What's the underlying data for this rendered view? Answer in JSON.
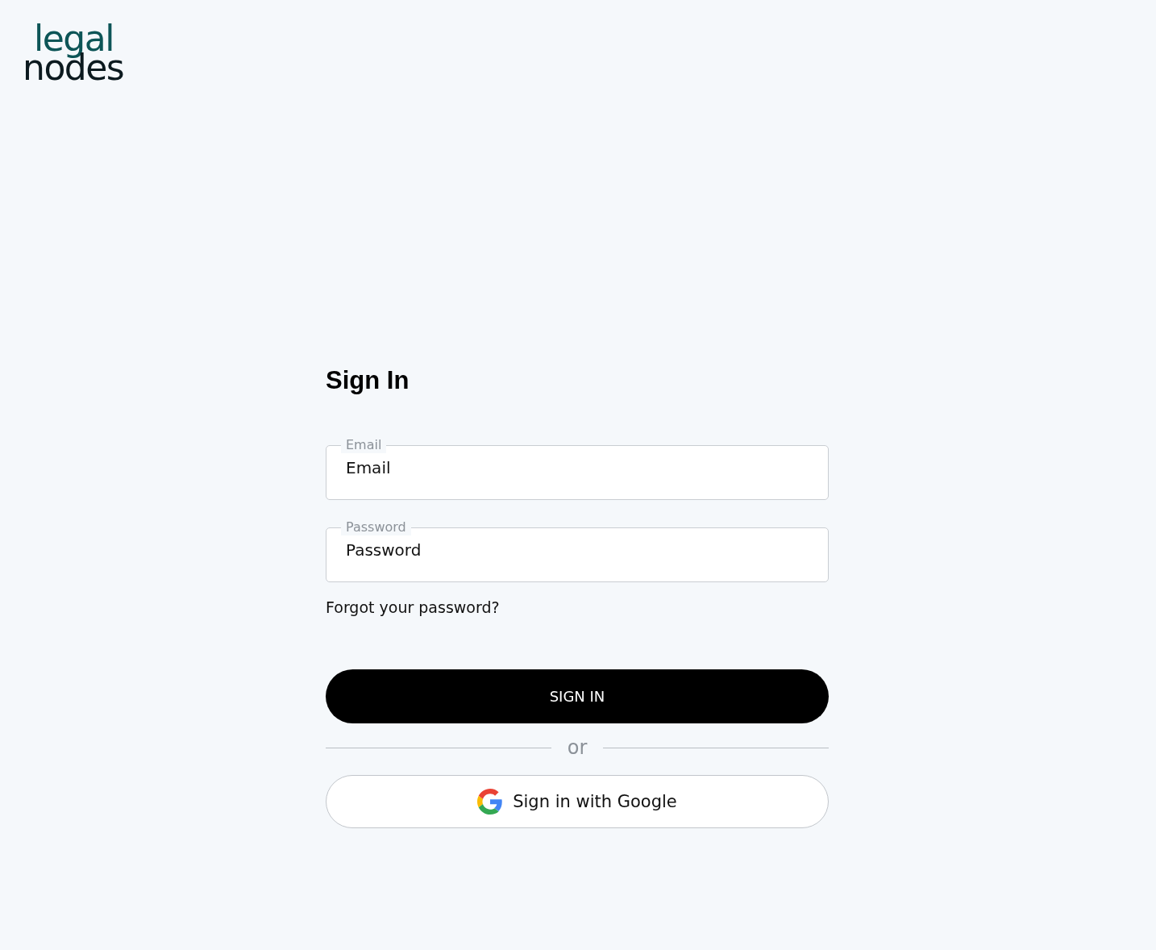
{
  "logo": {
    "lines": [
      "legal",
      "nodes"
    ]
  },
  "form": {
    "title": "Sign In",
    "fields": [
      {
        "label": "Email",
        "placeholder": "Email"
      },
      {
        "label": "Password",
        "placeholder": "Password"
      }
    ],
    "forgot_link": "Forgot your password?",
    "submit": "SIGN IN",
    "divider": "or",
    "google_button": "Sign in with Google"
  }
}
